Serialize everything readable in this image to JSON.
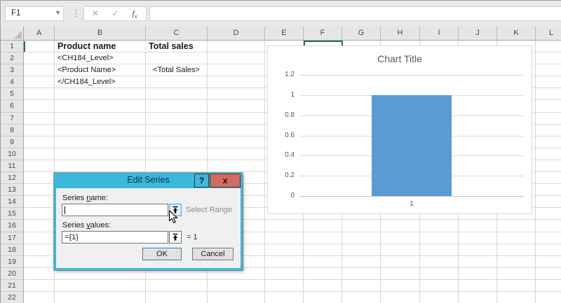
{
  "formula_bar": {
    "name_box_value": "F1",
    "formula_value": "",
    "icons": {
      "dropdown": "▾",
      "dots": "⋮",
      "cancel": "✕",
      "enter": "✓",
      "fx_f": "f",
      "fx_x": "x"
    }
  },
  "grid": {
    "column_headers": [
      "A",
      "B",
      "C",
      "D",
      "E",
      "F",
      "G",
      "H",
      "I",
      "J",
      "K",
      "L"
    ],
    "row_headers": [
      "1",
      "2",
      "3",
      "4",
      "5",
      "6",
      "7",
      "8",
      "9",
      "10",
      "11",
      "12",
      "13",
      "14",
      "15",
      "16",
      "17",
      "18",
      "19",
      "20",
      "21",
      "22"
    ],
    "selected_cell": "F1",
    "selection_color": "#217346",
    "cells": [
      {
        "ref": "B1",
        "text": "Product name",
        "bold": true
      },
      {
        "ref": "C1",
        "text": "Total sales",
        "bold": true
      },
      {
        "ref": "B2",
        "text": "<CH184_Level>"
      },
      {
        "ref": "B3",
        "text": "<Product Name>"
      },
      {
        "ref": "C3",
        "text": "<Total Sales>",
        "align": "center"
      },
      {
        "ref": "B4",
        "text": "</CH184_Level>"
      }
    ]
  },
  "chart_data": {
    "type": "bar",
    "title": "Chart Title",
    "categories": [
      "1"
    ],
    "values": [
      1
    ],
    "ylim": [
      0,
      1.2
    ],
    "yticks": [
      0,
      0.2,
      0.4,
      0.6,
      0.8,
      1,
      1.2
    ],
    "grid": true,
    "legend": "none",
    "bar_color": "#5B9BD5",
    "text_color": "#595959"
  },
  "dialog": {
    "title": "Edit Series",
    "help_label": "?",
    "close_label": "x",
    "series_name_label": "Series name:",
    "series_name_access_key": "n",
    "series_name_value": "",
    "series_values_label": "Series values:",
    "series_values_access_key": "v",
    "series_values_value": "={1}",
    "series_values_result": "= 1",
    "select_range_tooltip": "Select Range",
    "ok_label": "OK",
    "cancel_label": "Cancel",
    "title_bar_color": "#3bb8dc",
    "close_button_color": "#d26b60"
  }
}
